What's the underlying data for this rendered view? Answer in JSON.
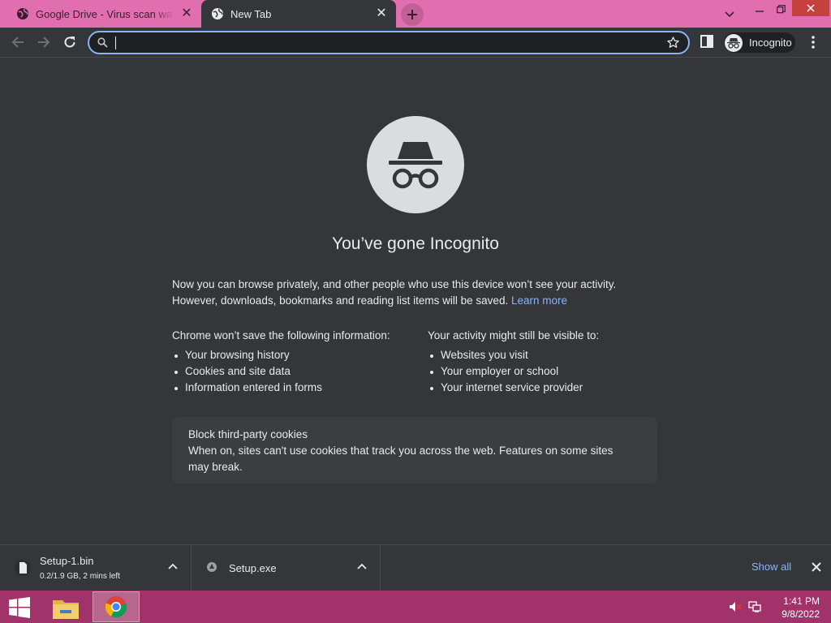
{
  "tabs": [
    {
      "title": "Google Drive - Virus scan warning",
      "active": false
    },
    {
      "title": "New Tab",
      "active": true
    }
  ],
  "toolbar": {
    "omnibox_value": "",
    "profile_label": "Incognito"
  },
  "page": {
    "heading": "You’ve gone Incognito",
    "intro_text": "Now you can browse privately, and other people who use this device won’t see your activity. However, downloads, bookmarks and reading list items will be saved.",
    "learn_more": "Learn more",
    "not_saved_heading": "Chrome won’t save the following information:",
    "not_saved_items": [
      "Your browsing history",
      "Cookies and site data",
      "Information entered in forms"
    ],
    "visible_heading": "Your activity might still be visible to:",
    "visible_items": [
      "Websites you visit",
      "Your employer or school",
      "Your internet service provider"
    ],
    "cookie_title": "Block third-party cookies",
    "cookie_desc": "When on, sites can't use cookies that track you across the web. Features on some sites may break."
  },
  "downloads": [
    {
      "name": "Setup-1.bin",
      "status": "0.2/1.9 GB, 2 mins left"
    },
    {
      "name": "Setup.exe",
      "status": ""
    }
  ],
  "shelf": {
    "show_all": "Show all"
  },
  "taskbar": {
    "time": "1:41 PM",
    "date": "9/8/2022"
  },
  "colors": {
    "accent": "#8ab4f8",
    "titlebar": "#e16fb0",
    "taskbar": "#a2336a",
    "background": "#35363a"
  }
}
